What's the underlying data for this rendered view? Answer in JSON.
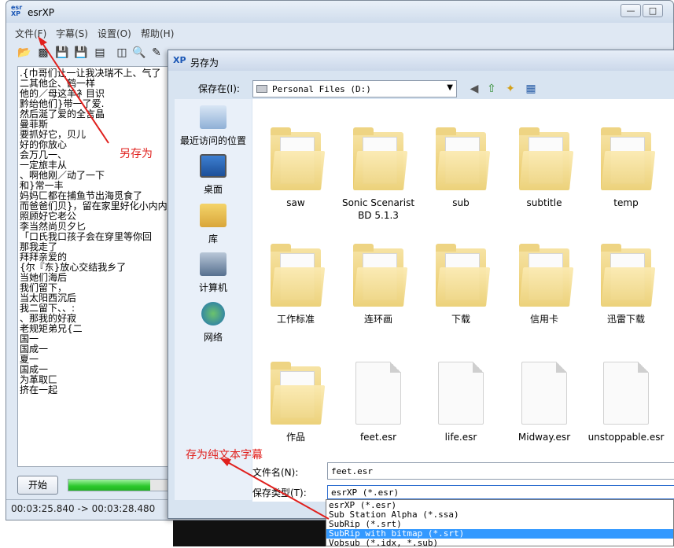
{
  "main": {
    "title": "esrXP",
    "logo_text": "esr\nXP",
    "menu": [
      "文件(F)",
      "字幕(S)",
      "设置(O)",
      "帮助(H)"
    ],
    "subtitle_lines": [
      ".{巾哥们让一让我决瑞不上、气了",
      "二其他企、鹤一样",
      "他的／母这羊衤目识",
      "黔绐他们}带一了爱.",
      "然后涎了爱的全言晶",
      "曼菲斯",
      "要抓好它，贝儿",
      "好的你放心",
      "会万几一、",
      "一定旅丰从",
      "、啊他刚／动了一下",
      "和}常一丰",
      "妈妈匚都在捕鱼节出海觅食了",
      "而爸爸们贝}，留在家里好化小内内",
      "照顾好它老公",
      "李当然尚贝夕匕",
      "「口氏我口孩子会在穿里等你回",
      "那我走了",
      "拜拜亲爱的",
      "{尔『东}放心交结我乡了",
      "当她们海后",
      "我们留下，",
      "当太阳西沉后",
      "我二留下、、:",
      "、那我的好寂",
      "老规矩弟兄{二",
      "国一",
      "国成一",
      "夏一",
      "国成一",
      "为革取匚",
      "挤在一起"
    ],
    "start_button": "开始",
    "progress": 0.75,
    "status_time": "00:03:25.840 -> 00:03:28.480"
  },
  "dialog": {
    "title": "另存为",
    "logo_text": "XP",
    "savein_label": "保存在(I):",
    "savein_value": "Personal Files (D:)",
    "places": [
      "最近访问的位置",
      "桌面",
      "库",
      "计算机",
      "网络"
    ],
    "files": [
      {
        "name": "saw",
        "kind": "folder"
      },
      {
        "name": "Sonic Scenarist BD 5.1.3",
        "kind": "folder"
      },
      {
        "name": "sub",
        "kind": "folder"
      },
      {
        "name": "subtitle",
        "kind": "folder"
      },
      {
        "name": "temp",
        "kind": "folder"
      },
      {
        "name": "工作标准",
        "kind": "folder"
      },
      {
        "name": "连环画",
        "kind": "folder"
      },
      {
        "name": "下载",
        "kind": "folder"
      },
      {
        "name": "信用卡",
        "kind": "folder"
      },
      {
        "name": "迅雷下载",
        "kind": "folder"
      },
      {
        "name": "作品",
        "kind": "folder"
      },
      {
        "name": "feet.esr",
        "kind": "file"
      },
      {
        "name": "life.esr",
        "kind": "file"
      },
      {
        "name": "Midway.esr",
        "kind": "file"
      },
      {
        "name": "unstoppable.esr",
        "kind": "file"
      }
    ],
    "filename_label": "文件名(N):",
    "filename_value": "feet.esr",
    "filetype_label": "保存类型(T):",
    "filetype_value": "esrXP (*.esr)",
    "filetype_options": [
      "esrXP (*.esr)",
      "Sub Station Alpha (*.ssa)",
      "SubRip (*.srt)",
      "SubRip with bitmap (*.srt)",
      "Vobsub (*.idx, *.sub)"
    ],
    "filetype_selected_index": 3
  },
  "annotations": {
    "save_as": "另存为",
    "save_plain_text": "存为纯文本字幕",
    "color": "#e0201d"
  }
}
